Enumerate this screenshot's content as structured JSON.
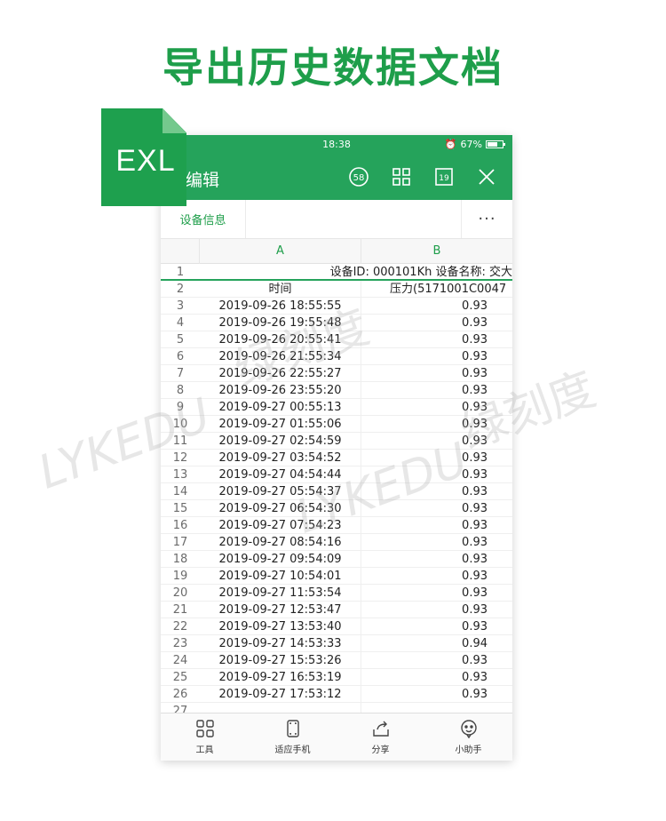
{
  "headline": "导出历史数据文档",
  "file_badge": "EXL",
  "status_bar": {
    "time": "18:38",
    "battery": "67%"
  },
  "app_bar": {
    "title": "编辑",
    "icons": [
      "counter-58-icon",
      "grid-view-icon",
      "sheet-19-icon",
      "close-icon"
    ],
    "counter_label": "58",
    "sheet_label": "19"
  },
  "tabs": {
    "active": "设备信息",
    "more": "···"
  },
  "columns": {
    "a": "A",
    "b": "B"
  },
  "row1": {
    "num": "1",
    "text": "设备ID: 000101Kh   设备名称: 交大"
  },
  "header_row": {
    "num": "2",
    "a": "时间",
    "b": "压力(5171001C0047"
  },
  "rows": [
    {
      "num": "3",
      "time": "2019-09-26 18:55:55",
      "value": "0.93"
    },
    {
      "num": "4",
      "time": "2019-09-26 19:55:48",
      "value": "0.93"
    },
    {
      "num": "5",
      "time": "2019-09-26 20:55:41",
      "value": "0.93"
    },
    {
      "num": "6",
      "time": "2019-09-26 21:55:34",
      "value": "0.93"
    },
    {
      "num": "7",
      "time": "2019-09-26 22:55:27",
      "value": "0.93"
    },
    {
      "num": "8",
      "time": "2019-09-26 23:55:20",
      "value": "0.93"
    },
    {
      "num": "9",
      "time": "2019-09-27 00:55:13",
      "value": "0.93"
    },
    {
      "num": "10",
      "time": "2019-09-27 01:55:06",
      "value": "0.93"
    },
    {
      "num": "11",
      "time": "2019-09-27 02:54:59",
      "value": "0.93"
    },
    {
      "num": "12",
      "time": "2019-09-27 03:54:52",
      "value": "0.93"
    },
    {
      "num": "13",
      "time": "2019-09-27 04:54:44",
      "value": "0.93"
    },
    {
      "num": "14",
      "time": "2019-09-27 05:54:37",
      "value": "0.93"
    },
    {
      "num": "15",
      "time": "2019-09-27 06:54:30",
      "value": "0.93"
    },
    {
      "num": "16",
      "time": "2019-09-27 07:54:23",
      "value": "0.93"
    },
    {
      "num": "17",
      "time": "2019-09-27 08:54:16",
      "value": "0.93"
    },
    {
      "num": "18",
      "time": "2019-09-27 09:54:09",
      "value": "0.93"
    },
    {
      "num": "19",
      "time": "2019-09-27 10:54:01",
      "value": "0.93"
    },
    {
      "num": "20",
      "time": "2019-09-27 11:53:54",
      "value": "0.93"
    },
    {
      "num": "21",
      "time": "2019-09-27 12:53:47",
      "value": "0.93"
    },
    {
      "num": "22",
      "time": "2019-09-27 13:53:40",
      "value": "0.93"
    },
    {
      "num": "23",
      "time": "2019-09-27 14:53:33",
      "value": "0.94"
    },
    {
      "num": "24",
      "time": "2019-09-27 15:53:26",
      "value": "0.93"
    },
    {
      "num": "25",
      "time": "2019-09-27 16:53:19",
      "value": "0.93"
    },
    {
      "num": "26",
      "time": "2019-09-27 17:53:12",
      "value": "0.93"
    },
    {
      "num": "27",
      "time": "",
      "value": ""
    }
  ],
  "toolbar": [
    {
      "label": "工具",
      "icon": "tools-grid-icon"
    },
    {
      "label": "适应手机",
      "icon": "fit-phone-icon"
    },
    {
      "label": "分享",
      "icon": "share-icon"
    },
    {
      "label": "小助手",
      "icon": "assistant-icon"
    }
  ],
  "watermarks": [
    "LYKEDU",
    "绿刻度"
  ],
  "colors": {
    "accent": "#25a35b",
    "headline": "#1e9e4a"
  }
}
